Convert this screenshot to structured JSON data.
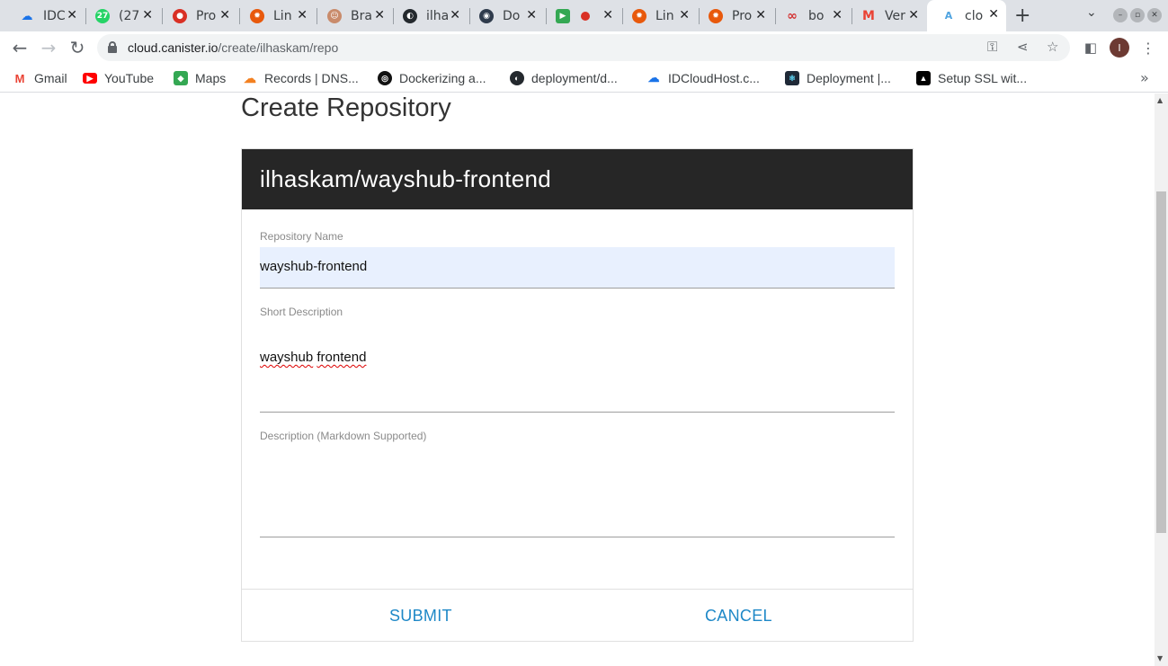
{
  "browser": {
    "tabs": [
      {
        "label": "IDC",
        "icon": "idcloudhost-icon",
        "color": "#1a73e8"
      },
      {
        "label": "(27",
        "icon": "whatsapp-icon",
        "color": "#25d366"
      },
      {
        "label": "Pro",
        "icon": "podcast-icon",
        "color": "#d93025"
      },
      {
        "label": "Lin",
        "icon": "grafana-icon",
        "color": "#e8590c"
      },
      {
        "label": "Bra",
        "icon": "avatar-icon",
        "color": "#c98b6b"
      },
      {
        "label": "ilha",
        "icon": "github-icon",
        "color": "#24292e"
      },
      {
        "label": "Do",
        "icon": "docs-icon",
        "color": "#2f3b4c"
      },
      {
        "label": "",
        "icon": "meet-icon",
        "color": "#34a853"
      },
      {
        "label": "Lin",
        "icon": "grafana-icon",
        "color": "#e8590c"
      },
      {
        "label": "Pro",
        "icon": "grafana-icon",
        "color": "#e8590c"
      },
      {
        "label": "bo",
        "icon": "infinity-icon",
        "color": "#d32f2f"
      },
      {
        "label": "Ver",
        "icon": "gmail-icon",
        "color": "#ea4335"
      },
      {
        "label": "clo",
        "icon": "canister-icon",
        "color": "#4fa3e0"
      }
    ],
    "url_host": "cloud.canister.io",
    "url_path": "/create/ilhaskam/repo",
    "profile_initial": "I"
  },
  "bookmarks": [
    {
      "label": "Gmail",
      "icon": "gmail-icon",
      "color": "#ea4335"
    },
    {
      "label": "YouTube",
      "icon": "youtube-icon",
      "color": "#ff0000"
    },
    {
      "label": "Maps",
      "icon": "maps-icon",
      "color": "#34a853"
    },
    {
      "label": "Records | DNS...",
      "icon": "cloudflare-icon",
      "color": "#f38020"
    },
    {
      "label": "Dockerizing a...",
      "icon": "circle-logo-icon",
      "color": "#111111"
    },
    {
      "label": "deployment/d...",
      "icon": "github-icon",
      "color": "#24292e"
    },
    {
      "label": "IDCloudHost.c...",
      "icon": "idcloudhost-icon",
      "color": "#1a73e8"
    },
    {
      "label": "Deployment |...",
      "icon": "react-icon",
      "color": "#1f2937"
    },
    {
      "label": "Setup SSL wit...",
      "icon": "tower-icon",
      "color": "#000000"
    }
  ],
  "page": {
    "title": "Create Repository",
    "card_header": "ilhaskam/wayshub-frontend",
    "fields": {
      "repo_name": {
        "label": "Repository Name",
        "value": "wayshub-frontend"
      },
      "short_desc": {
        "label": "Short Description",
        "value_word1": "wayshub",
        "value_word2": "frontend"
      },
      "description": {
        "label": "Description (Markdown Supported)",
        "value": ""
      }
    },
    "submit_label": "SUBMIT",
    "cancel_label": "CANCEL"
  },
  "colors": {
    "header_bg": "#262626",
    "action_blue": "#1e88c7",
    "autofill_bg": "#e8f0fe"
  }
}
